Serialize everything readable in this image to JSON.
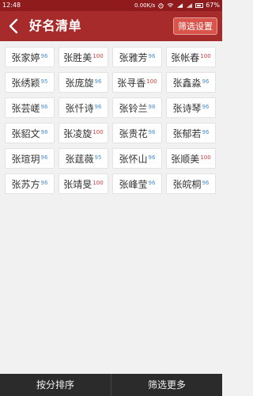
{
  "status_bar": {
    "time": "12:48",
    "network_speed": "0.00K/s",
    "battery": "67%"
  },
  "header": {
    "title": "好名清单",
    "filter_button": "筛选设置",
    "back_icon": "chevron-left-icon"
  },
  "names": [
    {
      "name": "张家婷",
      "score": "96",
      "color": "blue"
    },
    {
      "name": "张胜美",
      "score": "100",
      "color": "red"
    },
    {
      "name": "张雅芳",
      "score": "96",
      "color": "blue"
    },
    {
      "name": "张帐春",
      "score": "100",
      "color": "red"
    },
    {
      "name": "张绣颖",
      "score": "95",
      "color": "blue"
    },
    {
      "name": "张庞旋",
      "score": "96",
      "color": "blue"
    },
    {
      "name": "张寻香",
      "score": "100",
      "color": "red"
    },
    {
      "name": "张鑫淼",
      "score": "96",
      "color": "blue"
    },
    {
      "name": "张芸嵯",
      "score": "96",
      "color": "blue"
    },
    {
      "name": "张忏诗",
      "score": "96",
      "color": "blue"
    },
    {
      "name": "张铃兰",
      "score": "98",
      "color": "blue"
    },
    {
      "name": "张诗琴",
      "score": "96",
      "color": "blue"
    },
    {
      "name": "张貂文",
      "score": "98",
      "color": "blue"
    },
    {
      "name": "张凌旋",
      "score": "100",
      "color": "red"
    },
    {
      "name": "张贵花",
      "score": "96",
      "color": "blue"
    },
    {
      "name": "张郁若",
      "score": "96",
      "color": "blue"
    },
    {
      "name": "张瑄玥",
      "score": "96",
      "color": "blue"
    },
    {
      "name": "张莛薇",
      "score": "95",
      "color": "blue"
    },
    {
      "name": "张怀山",
      "score": "96",
      "color": "blue"
    },
    {
      "name": "张顺美",
      "score": "100",
      "color": "red"
    },
    {
      "name": "张苏方",
      "score": "96",
      "color": "blue"
    },
    {
      "name": "张靖旻",
      "score": "100",
      "color": "red"
    },
    {
      "name": "张峰莹",
      "score": "96",
      "color": "blue"
    },
    {
      "name": "张皖桐",
      "score": "96",
      "color": "blue"
    }
  ],
  "bottom_bar": {
    "sort_button": "按分排序",
    "more_button": "筛选更多"
  },
  "colors": {
    "header": "#a72b2b",
    "status_bar": "#8f1b1d",
    "score_blue": "#4a8ecf",
    "score_red": "#d23a36",
    "bottom_bar": "#2b2b2b"
  }
}
